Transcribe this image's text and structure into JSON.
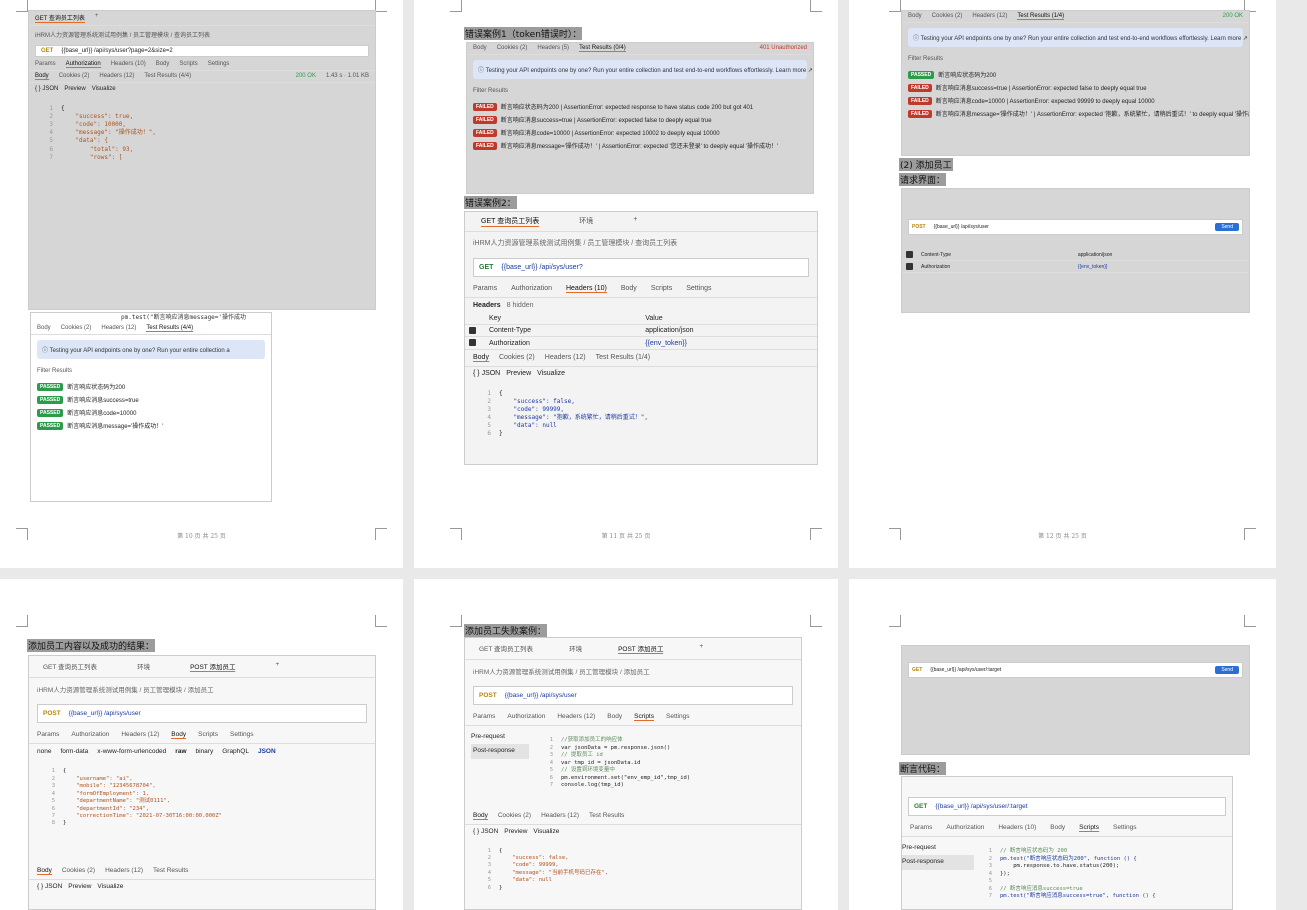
{
  "pages": {
    "p1": "第 10 页 共 25 页",
    "p2": "第 11 页 共 25 页",
    "p3": "第 12 页 共 25 页"
  },
  "p1": {
    "tabs": [
      "GET 查询员工列表",
      "+"
    ],
    "breadcrumb": "iHRM人力资源管理系统测试用例集 / 员工管理模块 / 查询员工列表",
    "method": "GET",
    "url": "{{base_url}} /api/sys/user?page=2&size=2",
    "req_tabs": [
      "Params",
      "Authorization",
      "Headers (10)",
      "Body",
      "Scripts",
      "Settings"
    ],
    "resp_tabs": [
      "Body",
      "Cookies (2)",
      "Headers (12)",
      "Test Results (4/4)"
    ],
    "status": "200 OK",
    "meta": "1.43 s  ·  1.01 KB",
    "view": [
      "{ } JSON",
      "Preview",
      "Visualize"
    ],
    "code": [
      "{",
      "    \"success\": true,",
      "    \"code\": 10000,",
      "    \"message\": \"操作成功！\",",
      "    \"data\": {",
      "        \"total\": 93,",
      "        \"rows\": ["
    ],
    "snippet": "pm.test(\"断言响应消息message='操作成功",
    "results_tabs": [
      "Body",
      "Cookies (2)",
      "Headers (12)",
      "Test Results (4/4)"
    ],
    "info": "Testing your API endpoints one by one? Run your entire collection a",
    "filter": "Filter Results",
    "results": [
      {
        "status": "PASSED",
        "text": "断言响应状态码为200"
      },
      {
        "status": "PASSED",
        "text": "断言响应消息success=true"
      },
      {
        "status": "PASSED",
        "text": "断言响应消息code=10000"
      },
      {
        "status": "PASSED",
        "text": "断言响应消息message='操作成功！'"
      }
    ]
  },
  "p2": {
    "caption1": "错误案例1（token错误时）：",
    "resp_tabs": [
      "Body",
      "Cookies (2)",
      "Headers (5)",
      "Test Results (0/4)"
    ],
    "status": "401 Unauthorized",
    "info": "Testing your API endpoints one by one? Run your entire collection and test end-to-end workflows effortlessly. Learn more ↗",
    "filter": "Filter Results",
    "results": [
      {
        "status": "FAILED",
        "text": "断言响应状态码为200 | AssertionError: expected response to have status code 200 but got 401"
      },
      {
        "status": "FAILED",
        "text": "断言响应消息success=true | AssertionError: expected false to deeply equal true"
      },
      {
        "status": "FAILED",
        "text": "断言响应消息code=10000 | AssertionError: expected 10002 to deeply equal 10000"
      },
      {
        "status": "FAILED",
        "text": "断言响应消息message='操作成功！' | AssertionError: expected '您还未登录' to deeply equal '操作成功！'"
      }
    ],
    "caption2": "错误案例2：",
    "tabs": [
      "GET 查询员工列表",
      "环境",
      "+"
    ],
    "breadcrumb": "iHRM人力资源管理系统测试用例集 / 员工管理模块 / 查询员工列表",
    "method": "GET",
    "url": "{{base_url}} /api/sys/user?",
    "req_tabs": [
      "Params",
      "Authorization",
      "Headers (10)",
      "Body",
      "Scripts",
      "Settings"
    ],
    "headers_label": "Headers",
    "hidden": "8 hidden",
    "kv_head": [
      "Key",
      "Value"
    ],
    "kv": [
      {
        "k": "Content-Type",
        "v": "application/json"
      },
      {
        "k": "Authorization",
        "v": "{{env_token}}"
      }
    ],
    "resp_tabs2": [
      "Body",
      "Cookies (2)",
      "Headers (12)",
      "Test Results (1/4)"
    ],
    "view": [
      "{ } JSON",
      "Preview",
      "Visualize"
    ],
    "code": [
      "{",
      "    \"success\": false,",
      "    \"code\": 99999,",
      "    \"message\": \"抱歉，系统繁忙，请稍后重试！\",",
      "    \"data\": null",
      "}"
    ]
  },
  "p3": {
    "resp_tabs": [
      "Body",
      "Cookies (2)",
      "Headers (12)",
      "Test Results (1/4)"
    ],
    "status": "200 OK",
    "info": "Testing your API endpoints one by one? Run your entire collection and test end-to-end workflows effortlessly. Learn more ↗",
    "filter": "Filter Results",
    "results": [
      {
        "status": "PASSED",
        "text": "断言响应状态码为200"
      },
      {
        "status": "FAILED",
        "text": "断言响应消息success=true | AssertionError: expected false to deeply equal true"
      },
      {
        "status": "FAILED",
        "text": "断言响应消息code=10000 | AssertionError: expected 99999 to deeply equal 10000"
      },
      {
        "status": "FAILED",
        "text": "断言响应消息message='操作成功！' | AssertionError: expected '抱歉，系统繁忙，请稍后重试！' to deeply equal '操作成功！'"
      }
    ],
    "caption1": "(2) 添加员工",
    "caption2": "请求界面：",
    "method": "POST",
    "url": "{{base_url}} /api/sys/user",
    "send": "Send",
    "kv": [
      {
        "k": "Content-Type",
        "v": "application/json"
      },
      {
        "k": "Authorization",
        "v": "{{env_token}}"
      }
    ]
  },
  "p4": {
    "caption": "添加员工内容以及成功的结果：",
    "tabs": [
      "GET 查询员工列表",
      "环境",
      "POST 添加员工",
      "+"
    ],
    "breadcrumb": "iHRM人力资源管理系统测试用例集 / 员工管理模块 / 添加员工",
    "method": "POST",
    "url": "{{base_url}} /api/sys/user",
    "req_tabs": [
      "Params",
      "Authorization",
      "Headers (12)",
      "Body",
      "Scripts",
      "Settings"
    ],
    "body_types": [
      "none",
      "form-data",
      "x-www-form-urlencoded",
      "raw",
      "binary",
      "GraphQL",
      "JSON"
    ],
    "code": [
      "{",
      "    \"username\": \"ai\",",
      "    \"mobile\": \"12345678704\",",
      "    \"formOfEmployment\": 1,",
      "    \"departmentName\": \"测试0111\",",
      "    \"departmentId\": \"234\",",
      "    \"correctionTime\": \"2021-07-30T16:00:00.000Z\"",
      "}"
    ],
    "resp_tabs": [
      "Body",
      "Cookies (2)",
      "Headers (12)",
      "Test Results"
    ],
    "view": [
      "{ } JSON",
      "Preview",
      "Visualize"
    ]
  },
  "p5": {
    "caption": "添加员工失败案例：",
    "tabs": [
      "GET 查询员工列表",
      "环境",
      "POST 添加员工",
      "+"
    ],
    "breadcrumb": "iHRM人力资源管理系统测试用例集 / 员工管理模块 / 添加员工",
    "method": "POST",
    "url": "{{base_url}} /api/sys/user",
    "req_tabs": [
      "Params",
      "Authorization",
      "Headers (12)",
      "Body",
      "Scripts",
      "Settings"
    ],
    "side": [
      "Pre-request",
      "Post-response"
    ],
    "script": [
      "//获取添加员工的响应体",
      "var jsonData = pm.response.json()",
      "// 提取员工 id",
      "var tmp_id = jsonData.id",
      "// 设置到环境变量中",
      "pm.environment.set(\"env_emp_id\",tmp_id)",
      "console.log(tmp_id)"
    ],
    "resp_tabs": [
      "Body",
      "Cookies (2)",
      "Headers (12)",
      "Test Results"
    ],
    "view": [
      "{ } JSON",
      "Preview",
      "Visualize"
    ],
    "code": [
      "{",
      "    \"success\": false,",
      "    \"code\": 99999,",
      "    \"message\": \"当前手机号码已存在\",",
      "    \"data\": null",
      "}"
    ]
  },
  "p6": {
    "method": "GET",
    "url": "{{base_url}} /api/sys/user/:target",
    "send": "Send",
    "caption": "断言代码：",
    "url2": "{{base_url}} /api/sys/user/:target",
    "req_tabs": [
      "Params",
      "Authorization",
      "Headers (10)",
      "Body",
      "Scripts",
      "Settings"
    ],
    "side": [
      "Pre-request",
      "Post-response"
    ],
    "script": [
      "// 断言响应状态码为 200",
      "pm.test(\"断言响应状态码为200\", function () {",
      "    pm.response.to.have.status(200);",
      "});",
      "",
      "// 断言响应消息success=true",
      "pm.test(\"断言响应消息success=true\", function () {"
    ]
  }
}
